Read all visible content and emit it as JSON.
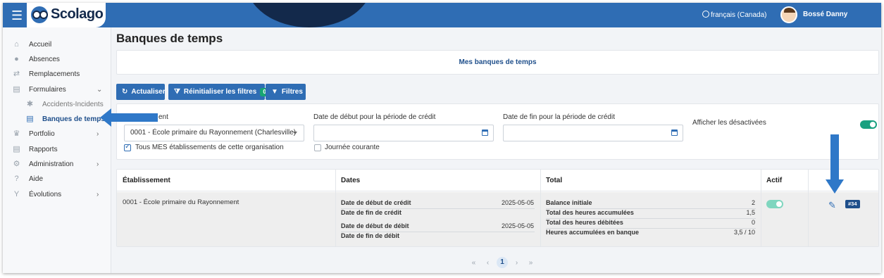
{
  "app": {
    "brand": "Scolago",
    "language": "français (Canada)",
    "user_name": "Bossé Danny"
  },
  "sidebar": {
    "items": [
      {
        "label": "Accueil",
        "icon": "home-icon"
      },
      {
        "label": "Absences",
        "icon": "user-absence-icon"
      },
      {
        "label": "Remplacements",
        "icon": "replacement-icon"
      },
      {
        "label": "Formulaires",
        "icon": "form-icon"
      },
      {
        "label": "Accidents-Incidents",
        "icon": "incident-icon"
      },
      {
        "label": "Banques de temps",
        "icon": "document-icon"
      },
      {
        "label": "Portfolio",
        "icon": "trophy-icon"
      },
      {
        "label": "Rapports",
        "icon": "report-icon"
      },
      {
        "label": "Administration",
        "icon": "gear-icon"
      },
      {
        "label": "Aide",
        "icon": "help-icon"
      },
      {
        "label": "Évolutions",
        "icon": "evolution-icon"
      }
    ]
  },
  "page": {
    "title": "Banques de temps",
    "tab": "Mes banques de temps"
  },
  "toolbar": {
    "refresh": "Actualiser",
    "reset": "Réinitialiser les filtres",
    "reset_count": "0",
    "filters": "Filtres"
  },
  "filters": {
    "establishment_label_partial": "ent",
    "establishment_value": "0001 - École primaire du Rayonnement (Charlesville)",
    "all_establishments": "Tous MES établissements de cette organisation",
    "start_label": "Date de début pour la période de crédit",
    "end_label": "Date de fin pour la période de crédit",
    "today": "Journée courante",
    "show_disabled": "Afficher les désactivées"
  },
  "table": {
    "headers": [
      "Établissement",
      "Dates",
      "Total",
      "Actif"
    ],
    "row": {
      "establishment": "0001 - École primaire du Rayonnement",
      "dates": [
        {
          "label": "Date de début de crédit",
          "value": "2025-05-05"
        },
        {
          "label": "Date de fin de crédit",
          "value": ""
        },
        {
          "label": "Date de début de débit",
          "value": "2025-05-05"
        },
        {
          "label": "Date de fin de débit",
          "value": ""
        }
      ],
      "totals": [
        {
          "label": "Balance initiale",
          "value": "2"
        },
        {
          "label": "Total des heures accumulées",
          "value": "1,5"
        },
        {
          "label": "Total des heures débitées",
          "value": "0"
        },
        {
          "label": "Heures accumulées en banque",
          "value": "3,5 / 10"
        }
      ],
      "id_badge": "#34"
    }
  },
  "pager": {
    "first": "«",
    "prev": "‹",
    "current": "1",
    "next": "›",
    "last": "»"
  },
  "colors": {
    "primary": "#2f6db4",
    "dark": "#13294b",
    "success": "#19a080",
    "arrow": "#2f78c8"
  }
}
